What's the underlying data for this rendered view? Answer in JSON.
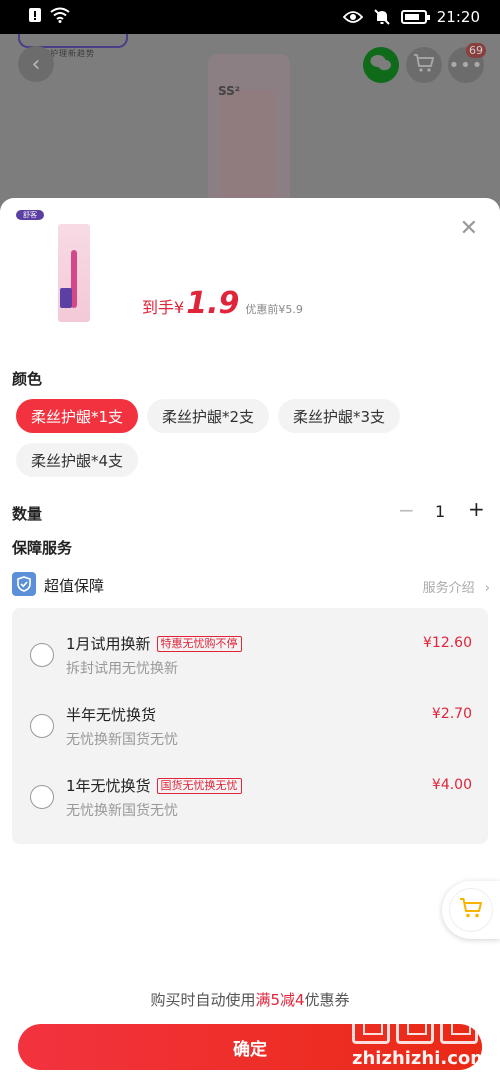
{
  "status_bar": {
    "time": "21:20",
    "battery_level": "full"
  },
  "background": {
    "product_mark": "SS²",
    "brand_slogan": "口腔护理新趋势",
    "cart_badge": "69"
  },
  "sheet": {
    "brand_logo": "舒客",
    "price": {
      "prefix": "到手",
      "currency": "¥",
      "value": "1.9",
      "original": "优惠前¥5.9"
    },
    "color_section": {
      "title": "颜色",
      "options": [
        {
          "label": "柔丝护龈*1支",
          "selected": true
        },
        {
          "label": "柔丝护龈*2支",
          "selected": false
        },
        {
          "label": "柔丝护龈*3支",
          "selected": false
        },
        {
          "label": "柔丝护龈*4支",
          "selected": false
        }
      ]
    },
    "quantity": {
      "title": "数量",
      "minus": "−",
      "value": "1",
      "plus": "+"
    },
    "service": {
      "title": "保障服务",
      "guarantee_label": "超值保障",
      "intro_link": "服务介绍",
      "plans": [
        {
          "name": "1月试用换新",
          "tag": "特惠无忧购不停",
          "desc": "拆封试用无忧换新",
          "price": "¥12.60"
        },
        {
          "name": "半年无忧换货",
          "tag": "",
          "desc": "无忧换新国货无忧",
          "price": "¥2.70"
        },
        {
          "name": "1年无忧换货",
          "tag": "国货无忧换无忧",
          "desc": "无忧换新国货无忧",
          "price": "¥4.00"
        }
      ]
    },
    "coupon": {
      "before": "购买时自动使用",
      "highlight": "满5减4",
      "after": "优惠券"
    },
    "confirm_label": "确定"
  },
  "watermark": {
    "text": "zhizhizhi.com"
  },
  "colors": {
    "accent": "#f2333f",
    "price_red": "#e0243a",
    "guarantee_blue": "#5b8fd6"
  }
}
